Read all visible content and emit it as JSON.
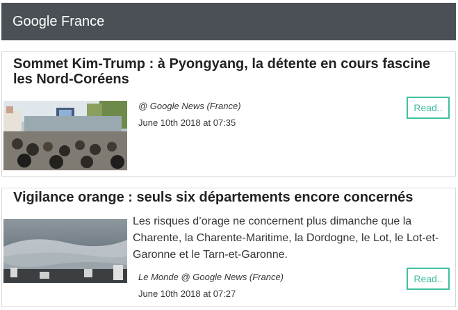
{
  "header": {
    "title": "Google France"
  },
  "articles": [
    {
      "title": "Sommet Kim-Trump : à Pyongyang, la détente en cours fascine les Nord-Coréens",
      "description": "",
      "source": "@ Google News (France)",
      "date": "June 10th 2018 at 07:35",
      "read_label": "Read.."
    },
    {
      "title": "Vigilance orange : seuls six départements encore concernés",
      "description": "Les risques d’orage ne concernent plus dimanche que la Charente, la Charente-Maritime, la Dordogne, le Lot, le Lot-et-Garonne et le Tarn-et-Garonne.",
      "source": "Le Monde @ Google News (France)",
      "date": "June 10th 2018 at 07:27",
      "read_label": "Read.."
    }
  ],
  "colors": {
    "header_bg": "#4a5055",
    "accent": "#3fbfa0"
  }
}
